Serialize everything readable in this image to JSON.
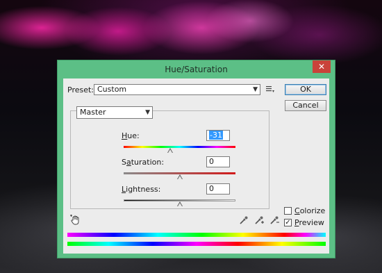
{
  "window": {
    "title": "Hue/Saturation",
    "close_glyph": "✕"
  },
  "preset": {
    "label": "Preset:",
    "value": "Custom"
  },
  "buttons": {
    "ok": "OK",
    "cancel": "Cancel"
  },
  "channel": {
    "value": "Master"
  },
  "adjustments": {
    "hue": {
      "label": "Hue:",
      "value": "-31",
      "min": -180,
      "max": 180
    },
    "saturation": {
      "label": "Saturation:",
      "value": "0",
      "min": -100,
      "max": 100
    },
    "lightness": {
      "label": "Lightness:",
      "value": "0",
      "min": -100,
      "max": 100
    }
  },
  "options": {
    "colorize": {
      "label": "Colorize",
      "checked": false
    },
    "preview": {
      "label": "Preview",
      "checked": true,
      "check_glyph": "✓"
    }
  },
  "icons": {
    "preset_options": "preset-options-icon",
    "on_image_adjust": "hand-adjust-icon",
    "eyedropper": "eyedropper-icon",
    "eyedropper_add": "eyedropper-add-icon",
    "eyedropper_subtract": "eyedropper-subtract-icon"
  },
  "colors": {
    "dialog_frame": "#5cbf86",
    "close_button": "#c9433a",
    "selection": "#3399ff"
  }
}
